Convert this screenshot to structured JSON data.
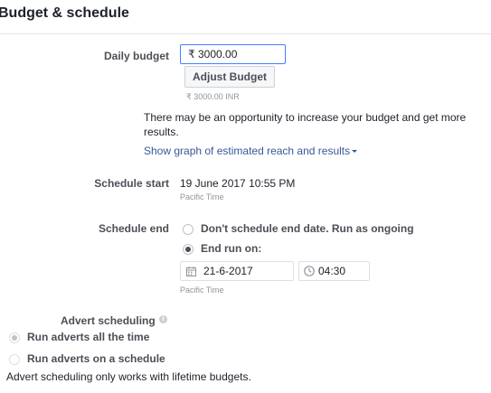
{
  "section": {
    "title": "Budget & schedule"
  },
  "budget": {
    "label": "Daily budget",
    "currency_symbol": "₹",
    "value": "3000.00",
    "adjust_label": "Adjust Budget",
    "converted": "₹ 3000.00 INR",
    "notice": "There may be an opportunity to increase your budget and get more results.",
    "graph_link": "Show graph of estimated reach and results"
  },
  "schedule_start": {
    "label": "Schedule start",
    "value": "19 June 2017 10:55 PM",
    "timezone": "Pacific Time"
  },
  "schedule_end": {
    "label": "Schedule end",
    "options": [
      {
        "label": "Don't schedule end date. Run as ongoing",
        "checked": false
      },
      {
        "label": "End run on:",
        "checked": true
      }
    ],
    "date": "21-6-2017",
    "time": "04:30",
    "timezone": "Pacific Time"
  },
  "advert_scheduling": {
    "label": "Advert scheduling",
    "info_icon": "info-icon",
    "options": [
      {
        "label": "Run adverts all the time",
        "checked": true
      },
      {
        "label": "Run adverts on a schedule",
        "checked": false
      }
    ],
    "note": "Advert scheduling only works with lifetime budgets."
  },
  "colors": {
    "link": "#365899",
    "focus_border": "#4080ff",
    "label": "#4b4f56"
  }
}
